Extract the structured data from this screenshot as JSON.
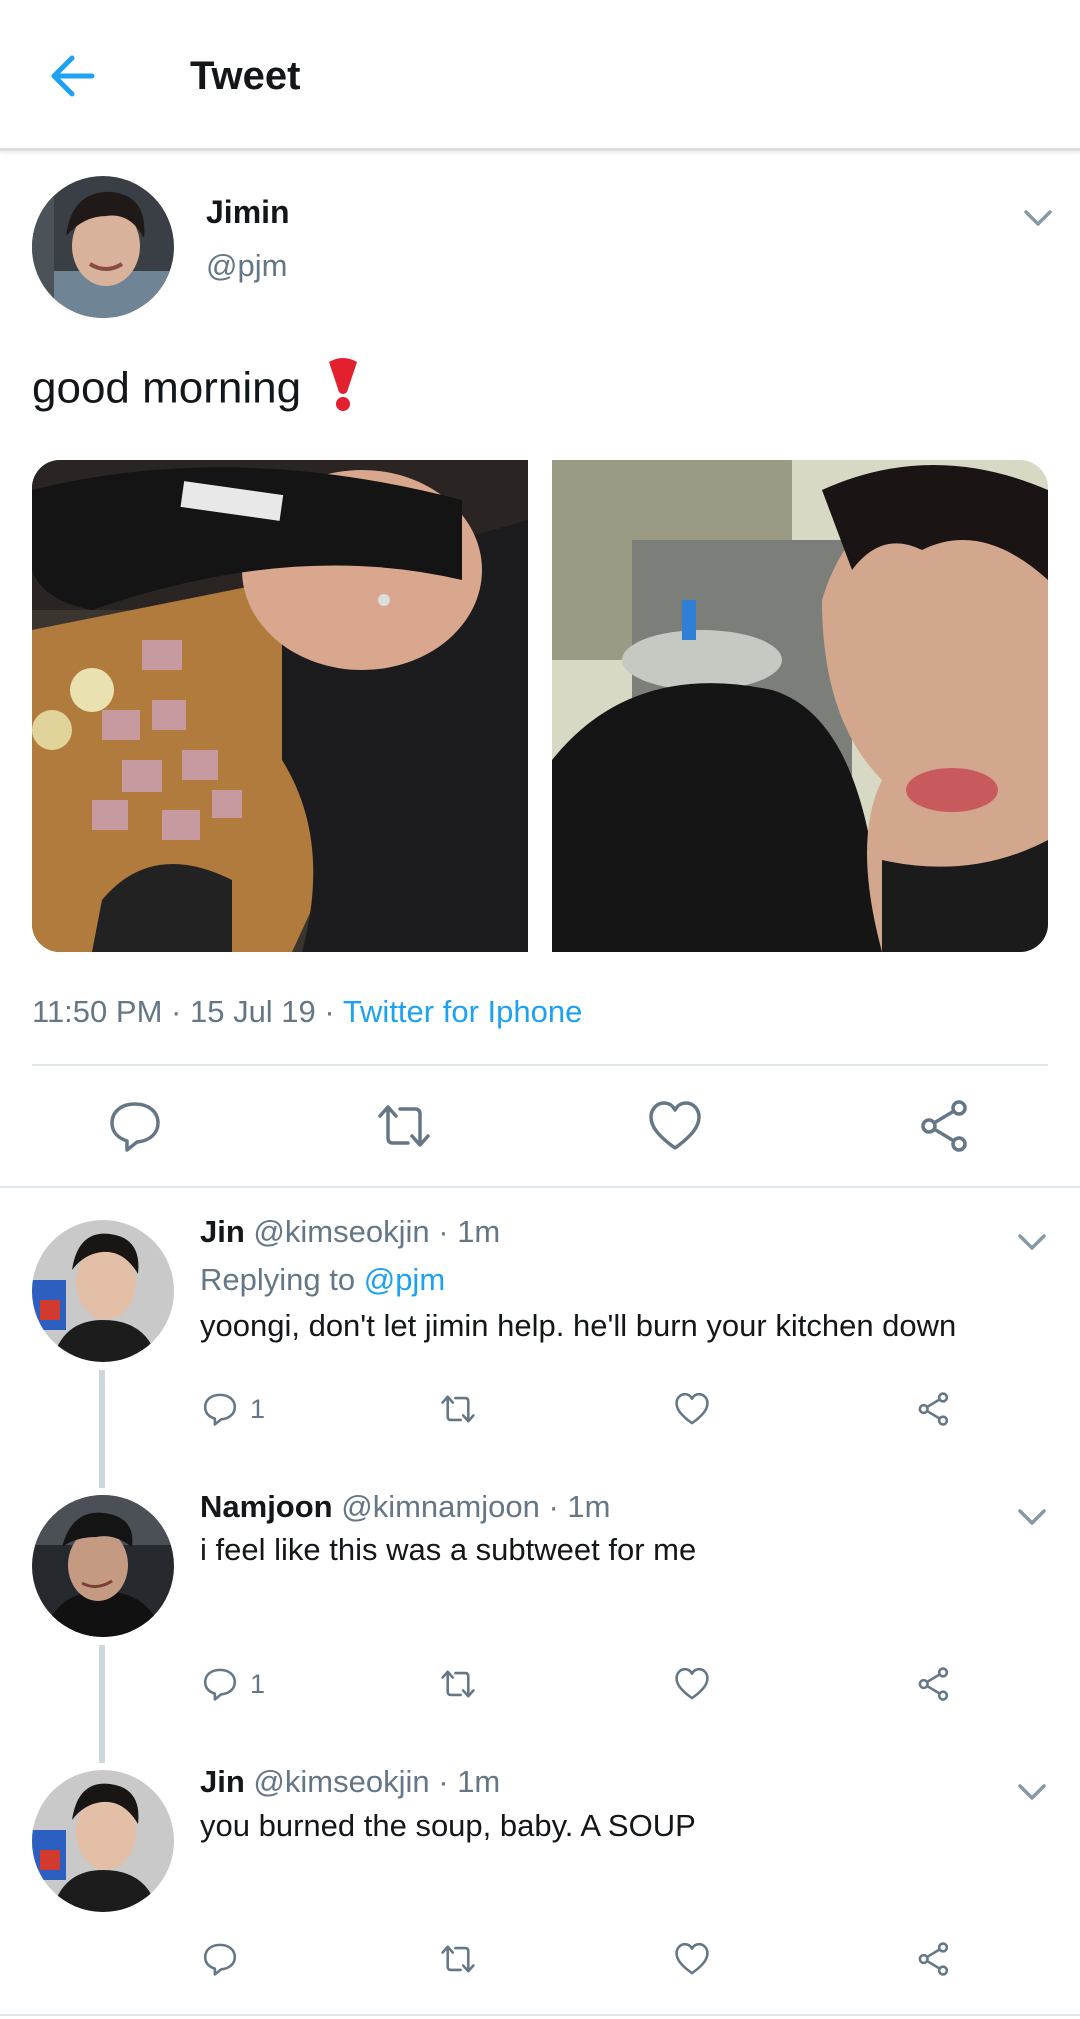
{
  "header": {
    "title": "Tweet"
  },
  "tweet": {
    "author_name": "Jimin",
    "author_handle": "@pjm",
    "text": "good morning",
    "time": "11:50 PM",
    "date": "15 Jul 19",
    "separator": "·",
    "client": "Twitter for Iphone"
  },
  "replies": [
    {
      "name": "Jin",
      "handle": "@kimseokjin",
      "time": "1m",
      "replying_label": "Replying to",
      "replying_to": "@pjm",
      "text": "yoongi, don't let jimin help. he'll burn your kitchen down",
      "reply_count": "1"
    },
    {
      "name": "Namjoon",
      "handle": "@kimnamjoon",
      "time": "1m",
      "text": "i feel like this was a subtweet for me",
      "reply_count": "1"
    },
    {
      "name": "Jin",
      "handle": "@kimseokjin",
      "time": "1m",
      "text": "you burned the soup, baby.  A SOUP",
      "reply_count": ""
    }
  ],
  "colors": {
    "accent": "#1da1f2",
    "secondary_text": "#657786",
    "icon": "#657786",
    "divider": "#e1e8ed"
  },
  "icons": {
    "back": "arrow-left-icon",
    "more": "chevron-down-icon",
    "reply": "speech-bubble-icon",
    "retweet": "retweet-icon",
    "like": "heart-icon",
    "share": "share-icon",
    "emoji": "red-exclamation-mark-emoji"
  }
}
